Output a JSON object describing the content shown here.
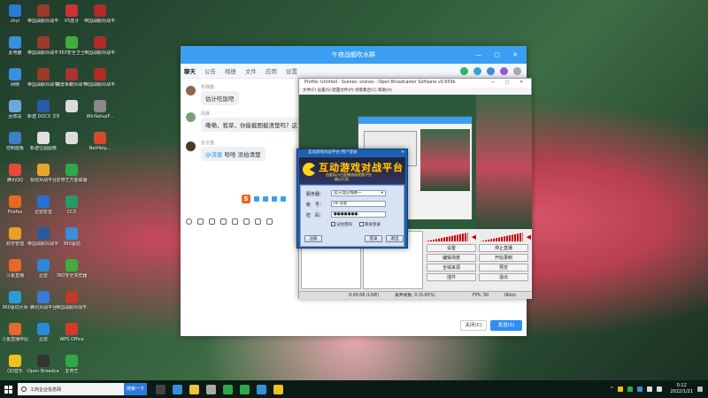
{
  "desktop": {
    "icons": [
      {
        "label": "zhyi",
        "color": "#2b7bd6",
        "col": 0,
        "row": 0
      },
      {
        "label": "帝国战舰对战平台",
        "color": "#9a3a2a",
        "col": 1,
        "row": 0
      },
      {
        "label": "VS蓝牙",
        "color": "#c33",
        "col": 2,
        "row": 0
      },
      {
        "label": "帝国战舰对战平台",
        "color": "#b02a2a",
        "col": 3,
        "row": 0
      },
      {
        "label": "此电脑",
        "color": "#3a8edb",
        "col": 0,
        "row": 1
      },
      {
        "label": "帝国战舰对战平台5",
        "color": "#9a3a2a",
        "col": 1,
        "row": 1
      },
      {
        "label": "360安全卫士",
        "color": "#3fae3f",
        "col": 2,
        "row": 1
      },
      {
        "label": "帝国战舰对战平台",
        "color": "#b02a2a",
        "col": 3,
        "row": 1
      },
      {
        "label": "网络",
        "color": "#3a8edb",
        "col": 0,
        "row": 2
      },
      {
        "label": "帝国战舰对战平台",
        "color": "#9a3a2a",
        "col": 1,
        "row": 2
      },
      {
        "label": "魔兽争霸对战平台",
        "color": "#a33",
        "col": 2,
        "row": 2
      },
      {
        "label": "帝国战舰对战平台",
        "color": "#b02a2a",
        "col": 3,
        "row": 2
      },
      {
        "label": "回收站",
        "color": "#6fa7d8",
        "col": 0,
        "row": 3
      },
      {
        "label": "新建 DOCX 文档",
        "color": "#2a5aa8",
        "col": 1,
        "row": 3
      },
      {
        "label": "",
        "color": "#ddd",
        "col": 2,
        "row": 3
      },
      {
        "label": "WinSetupF...",
        "color": "#8a8a8a",
        "col": 3,
        "row": 3
      },
      {
        "label": "控制面板",
        "color": "#3f7fc8",
        "col": 0,
        "row": 4
      },
      {
        "label": "新建位图图像",
        "color": "#e0e0e0",
        "col": 1,
        "row": 4
      },
      {
        "label": "",
        "color": "#ddd",
        "col": 2,
        "row": 4
      },
      {
        "label": "NetHelp...",
        "color": "#d64a2a",
        "col": 3,
        "row": 4
      },
      {
        "label": "腾讯QQ",
        "color": "#e84a3a",
        "col": 0,
        "row": 5
      },
      {
        "label": "极限对战平台",
        "color": "#e8a628",
        "col": 1,
        "row": 5
      },
      {
        "label": "爱奇艺万能联播",
        "color": "#2fa84a",
        "col": 2,
        "row": 5
      },
      {
        "label": "Firefox",
        "color": "#e86a1e",
        "col": 0,
        "row": 6
      },
      {
        "label": "迅雷影音",
        "color": "#2a6fd6",
        "col": 1,
        "row": 6
      },
      {
        "label": "CCD",
        "color": "#2a9a6a",
        "col": 2,
        "row": 6
      },
      {
        "label": "财务管理",
        "color": "#e8a028",
        "col": 0,
        "row": 7
      },
      {
        "label": "帝国战舰对战平台",
        "color": "#2a5a9a",
        "col": 1,
        "row": 7
      },
      {
        "label": "360驱动",
        "color": "#3a8edb",
        "col": 2,
        "row": 7
      },
      {
        "label": "斗鱼直播",
        "color": "#e8682a",
        "col": 0,
        "row": 8
      },
      {
        "label": "迅雷",
        "color": "#2a8ad8",
        "col": 1,
        "row": 8
      },
      {
        "label": "360安全浏览器",
        "color": "#3fae3f",
        "col": 2,
        "row": 8
      },
      {
        "label": "360驱动大师",
        "color": "#2a9ad8",
        "col": 0,
        "row": 9
      },
      {
        "label": "腾讯对战平台",
        "color": "#3a7ad8",
        "col": 1,
        "row": 9
      },
      {
        "label": "帝国战舰对战平台",
        "color": "#c23a2a",
        "col": 2,
        "row": 9
      },
      {
        "label": "斗鱼直播伴侣",
        "color": "#e8682a",
        "col": 0,
        "row": 10
      },
      {
        "label": "迅雷",
        "color": "#2a8ad8",
        "col": 1,
        "row": 10
      },
      {
        "label": "WPS Office",
        "color": "#d83a2a",
        "col": 2,
        "row": 10
      },
      {
        "label": "QQ音乐",
        "color": "#f0c020",
        "col": 0,
        "row": 11
      },
      {
        "label": "Open Broadcast...",
        "color": "#333",
        "col": 1,
        "row": 11
      },
      {
        "label": "爱奇艺",
        "color": "#2fa84a",
        "col": 2,
        "row": 11
      }
    ]
  },
  "qq_window": {
    "title": "午夜战舰吹水群",
    "tabs": [
      "聊天",
      "公告",
      "相册",
      "文件",
      "应用",
      "设置"
    ],
    "messages": [
      {
        "name": "布偶猫",
        "text": "估计吃饭吧",
        "avatar": "#8a6a4a"
      },
      {
        "name": "风暴",
        "text": "嘞嘞，我草，你能截图截清楚吗？这",
        "avatar": "#7aa07a"
      },
      {
        "name": "言言猫",
        "text": "@流星 哈哈 没拍清楚",
        "mention": "@流星",
        "body": " 哈哈 没拍清楚",
        "avatar": "#4a3a2a"
      }
    ],
    "close_label": "关闭(C)",
    "send_label": "发送(S)"
  },
  "obs_window": {
    "title": "Profile: Untitled - Scenes: scenes - Open Broadcaster Software v0.659b",
    "menu": "文件(F)   设置(S)   配置文件(P)   场景集合(C)   帮助(H)",
    "buttons": [
      "设置",
      "编辑场景",
      "全域来源",
      "插件",
      "停止直播",
      "开始录制",
      "预览",
      "退出"
    ],
    "status": {
      "time": "0:00:06 (LIVE)",
      "dropped": "丢弃帧数: 0 (0.00%)",
      "fps": "FPS: 30",
      "bitrate": "0kb/s"
    }
  },
  "game_dialog": {
    "title": "互动游戏对战平台-用户登录",
    "banner_main": "互动游戏对战平台",
    "banner_sub1": "由星际小白直播游戏视频平台",
    "banner_sub2": "精心打造",
    "server_label": "服务器：",
    "server_value": "官方电信线路一",
    "account_label": "帐　号：",
    "account_value": "ht-流星",
    "password_label": "密　码：",
    "password_value": "●●●●●●●",
    "remember_label": "记住密码",
    "hidden_label": "隐身登录",
    "register_label": "注册",
    "login_label": "登录",
    "exit_label": "退出"
  },
  "taskbar": {
    "search_text": "工商企业信息网",
    "search_button": "搜索一下",
    "apps": [
      "#444",
      "#3a8ed8",
      "#f0c040",
      "#aaa",
      "#2fa84a",
      "#2fa84a",
      "#3a8ed8",
      "#f0c020"
    ],
    "time": "0:12",
    "date": "2022/1/21"
  }
}
